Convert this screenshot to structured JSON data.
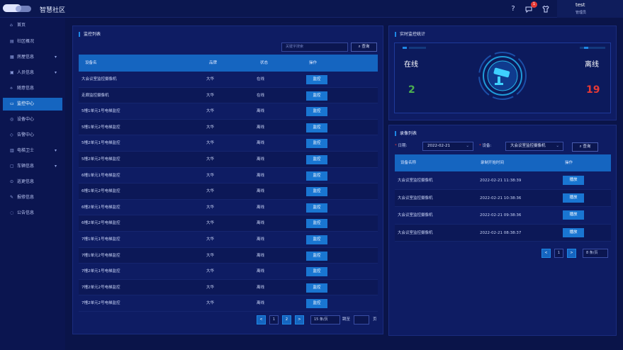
{
  "header": {
    "app_title": "智慧社区",
    "notification_count": "1",
    "user_name": "test",
    "user_role": "管理员"
  },
  "sidebar": {
    "items": [
      {
        "label": "首页",
        "icon": "home-icon"
      },
      {
        "label": "社区概况",
        "icon": "grid-icon"
      },
      {
        "label": "房屋信息",
        "icon": "house-icon"
      },
      {
        "label": "人员信息",
        "icon": "people-icon"
      },
      {
        "label": "随意信息",
        "icon": "share-icon"
      },
      {
        "label": "监控中心",
        "icon": "camera-icon"
      },
      {
        "label": "设备中心",
        "icon": "device-icon"
      },
      {
        "label": "告警中心",
        "icon": "alarm-icon"
      },
      {
        "label": "电梯卫士",
        "icon": "elevator-icon"
      },
      {
        "label": "车辆信息",
        "icon": "car-icon"
      },
      {
        "label": "巡更信息",
        "icon": "patrol-icon"
      },
      {
        "label": "报修信息",
        "icon": "repair-icon"
      },
      {
        "label": "公告信息",
        "icon": "notice-icon"
      }
    ]
  },
  "monitor": {
    "title": "监控列表",
    "search_placeholder": "关键字搜索",
    "search_button": "查询",
    "columns": [
      "设备名",
      "品牌",
      "状态",
      "操作"
    ],
    "op_label": "监控",
    "rows": [
      {
        "name": "大会议室监控摄像机",
        "brand": "大华",
        "status": "在线"
      },
      {
        "name": "走廊监控摄像机",
        "brand": "大华",
        "status": "在线"
      },
      {
        "name": "5幢1单元1号电梯监控",
        "brand": "大华",
        "status": "离线"
      },
      {
        "name": "5幢1单元2号电梯监控",
        "brand": "大华",
        "status": "离线"
      },
      {
        "name": "5幢2单元1号电梯监控",
        "brand": "大华",
        "status": "离线"
      },
      {
        "name": "5幢2单元2号电梯监控",
        "brand": "大华",
        "status": "离线"
      },
      {
        "name": "6幢1单元1号电梯监控",
        "brand": "大华",
        "status": "离线"
      },
      {
        "name": "6幢1单元2号电梯监控",
        "brand": "大华",
        "status": "离线"
      },
      {
        "name": "6幢2单元1号电梯监控",
        "brand": "大华",
        "status": "离线"
      },
      {
        "name": "6幢2单元2号电梯监控",
        "brand": "大华",
        "status": "离线"
      },
      {
        "name": "7幢1单元1号电梯监控",
        "brand": "大华",
        "status": "离线"
      },
      {
        "name": "7幢1单元2号电梯监控",
        "brand": "大华",
        "status": "离线"
      },
      {
        "name": "7幢2单元1号电梯监控",
        "brand": "大华",
        "status": "离线"
      },
      {
        "name": "7幢2单元2号电梯监控",
        "brand": "大华",
        "status": "离线"
      },
      {
        "name": "7幢2单元2号电梯监控",
        "brand": "大华",
        "status": "离线"
      }
    ],
    "pager": {
      "prev": "<",
      "page1": "1",
      "page2": "2",
      "next": ">",
      "size": "15 条/页",
      "jump_label": "跳至",
      "page_unit": "页"
    }
  },
  "stats": {
    "title": "实时监控统计",
    "online_label": "在线",
    "online_count": "2",
    "offline_label": "离线",
    "offline_count": "19"
  },
  "record": {
    "title": "录像列表",
    "date_label": "日期:",
    "date_value": "2022-02-21",
    "device_label": "设备:",
    "device_value": "大会议室监控摄像机",
    "search_button": "查询",
    "columns": [
      "设备名称",
      "录制开始时间",
      "操作"
    ],
    "op_label": "播放",
    "rows": [
      {
        "name": "大会议室监控摄像机",
        "time": "2022-02-21 11:38:39"
      },
      {
        "name": "大会议室监控摄像机",
        "time": "2022-02-21 10:38:36"
      },
      {
        "name": "大会议室监控摄像机",
        "time": "2022-02-21 09:38:36"
      },
      {
        "name": "大会议室监控摄像机",
        "time": "2022-02-21 08:38:37"
      }
    ],
    "pager": {
      "prev": "<",
      "page1": "1",
      "next": ">",
      "size": "8 条/页"
    }
  },
  "colors": {
    "accent": "#1565c0",
    "online": "#4caf50",
    "offline": "#e53935",
    "background": "#0a1449"
  }
}
